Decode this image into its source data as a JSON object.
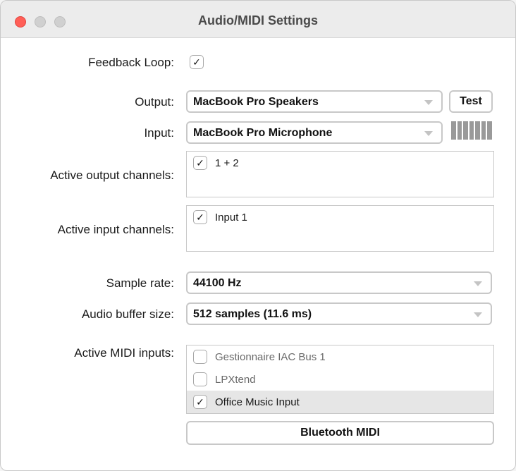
{
  "window": {
    "title": "Audio/MIDI Settings"
  },
  "feedback_loop": {
    "label": "Feedback Loop:",
    "checked": true
  },
  "output": {
    "label": "Output:",
    "value": "MacBook Pro Speakers",
    "test_label": "Test"
  },
  "input": {
    "label": "Input:",
    "value": "MacBook Pro Microphone"
  },
  "active_output_channels": {
    "label": "Active output channels:",
    "items": [
      {
        "label": "1 + 2",
        "checked": true
      }
    ]
  },
  "active_input_channels": {
    "label": "Active input channels:",
    "items": [
      {
        "label": "Input 1",
        "checked": true
      }
    ]
  },
  "sample_rate": {
    "label": "Sample rate:",
    "value": "44100 Hz"
  },
  "buffer_size": {
    "label": "Audio buffer size:",
    "value": "512 samples (11.6 ms)"
  },
  "midi_inputs": {
    "label": "Active MIDI inputs:",
    "items": [
      {
        "label": "Gestionnaire IAC Bus 1",
        "checked": false
      },
      {
        "label": "LPXtend",
        "checked": false
      },
      {
        "label": "Office Music Input",
        "checked": true
      }
    ]
  },
  "bluetooth_midi": {
    "label": "Bluetooth MIDI"
  },
  "check_glyph": "✓"
}
